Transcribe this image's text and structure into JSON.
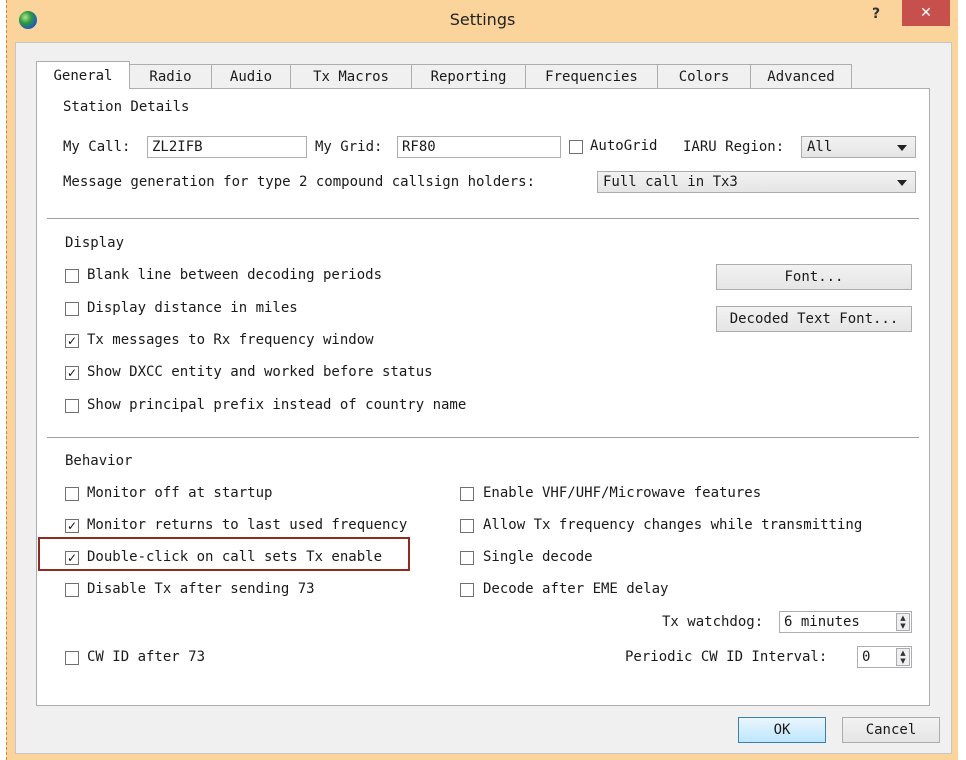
{
  "window": {
    "title": "Settings",
    "help_label": "?",
    "close_label": "✕"
  },
  "tabs": [
    "General",
    "Radio",
    "Audio",
    "Tx Macros",
    "Reporting",
    "Frequencies",
    "Colors",
    "Advanced"
  ],
  "active_tab": "General",
  "station": {
    "title": "Station Details",
    "my_call_label": "My Call:",
    "my_call_value": "ZL2IFB",
    "my_grid_label": "My Grid:",
    "my_grid_value": "RF80",
    "autogrid_label": "AutoGrid",
    "autogrid_checked": false,
    "iaru_label": "IARU Region:",
    "iaru_value": "All",
    "msg_gen_label": "Message generation for type 2 compound callsign holders:",
    "msg_gen_value": "Full call in Tx3"
  },
  "display": {
    "title": "Display",
    "options": [
      {
        "label": "Blank line between decoding periods",
        "checked": false
      },
      {
        "label": "Display distance in miles",
        "checked": false
      },
      {
        "label": "Tx messages to Rx frequency window",
        "checked": true
      },
      {
        "label": "Show DXCC entity and worked before status",
        "checked": true
      },
      {
        "label": "Show principal prefix instead of country name",
        "checked": false
      }
    ],
    "font_button": "Font...",
    "decoded_font_button": "Decoded Text Font..."
  },
  "behavior": {
    "title": "Behavior",
    "left_options": [
      {
        "label": "Monitor off at startup",
        "checked": false
      },
      {
        "label": "Monitor returns to last used frequency",
        "checked": true
      },
      {
        "label": "Double-click on call sets Tx enable",
        "checked": true
      },
      {
        "label": "Disable Tx after sending 73",
        "checked": false
      }
    ],
    "right_options": [
      {
        "label": "Enable VHF/UHF/Microwave features",
        "checked": false
      },
      {
        "label": "Allow Tx frequency changes while transmitting",
        "checked": false
      },
      {
        "label": "Single decode",
        "checked": false
      },
      {
        "label": "Decode after EME delay",
        "checked": false
      }
    ],
    "watchdog_label": "Tx watchdog:",
    "watchdog_value": "6 minutes",
    "cwid_label": "CW ID after 73",
    "cwid_checked": false,
    "periodic_label": "Periodic CW ID Interval:",
    "periodic_value": "0"
  },
  "footer": {
    "ok_label": "OK",
    "cancel_label": "Cancel"
  },
  "colors": {
    "titlebar": "#fbd49c",
    "close": "#c7504d",
    "highlight": "#8c2c1f"
  }
}
